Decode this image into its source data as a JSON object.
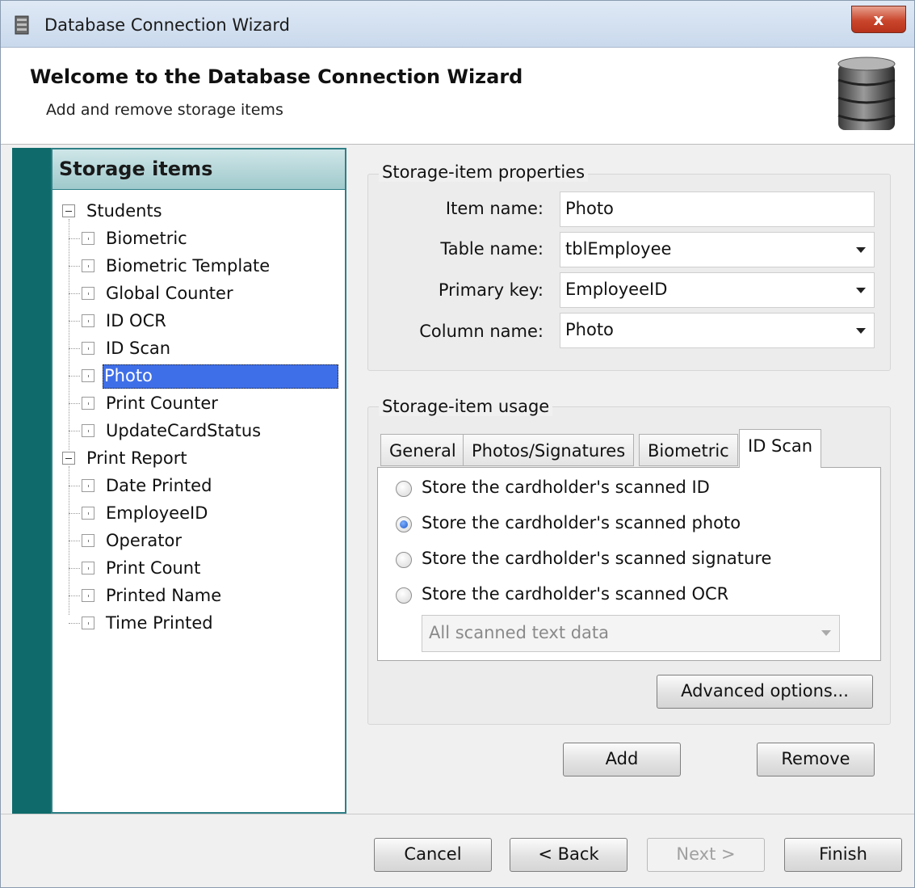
{
  "window": {
    "title": "Database Connection Wizard",
    "close_glyph": "x"
  },
  "header": {
    "title": "Welcome to the Database Connection Wizard",
    "subtitle": "Add and remove storage items",
    "icon": "database-icon"
  },
  "tree": {
    "header": "Storage items",
    "groups": [
      {
        "label": "Students",
        "children": [
          "Biometric",
          "Biometric Template",
          "Global Counter",
          "ID OCR",
          "ID Scan",
          "Photo",
          "Print Counter",
          "UpdateCardStatus"
        ]
      },
      {
        "label": "Print Report",
        "children": [
          "Date Printed",
          "EmployeeID",
          "Operator",
          "Print Count",
          "Printed Name",
          "Time Printed"
        ]
      }
    ],
    "selected": "Photo"
  },
  "properties": {
    "title": "Storage-item properties",
    "item_name_label": "Item name:",
    "item_name_value": "Photo",
    "table_name_label": "Table name:",
    "table_name_value": "tblEmployee",
    "primary_key_label": "Primary key:",
    "primary_key_value": "EmployeeID",
    "column_name_label": "Column name:",
    "column_name_value": "Photo"
  },
  "usage": {
    "title": "Storage-item usage",
    "tabs": [
      "General",
      "Photos/Signatures",
      "Biometric",
      "ID Scan"
    ],
    "active_tab": "ID Scan",
    "options": [
      "Store the cardholder's scanned ID",
      "Store the cardholder's scanned photo",
      "Store the cardholder's scanned signature",
      "Store the cardholder's scanned OCR"
    ],
    "selected_option": "Store the cardholder's scanned photo",
    "ocr_combo_value": "All scanned text data",
    "advanced_button": "Advanced options..."
  },
  "actions": {
    "add": "Add",
    "remove": "Remove"
  },
  "footer": {
    "cancel": "Cancel",
    "back": "< Back",
    "next": "Next >",
    "finish": "Finish"
  }
}
